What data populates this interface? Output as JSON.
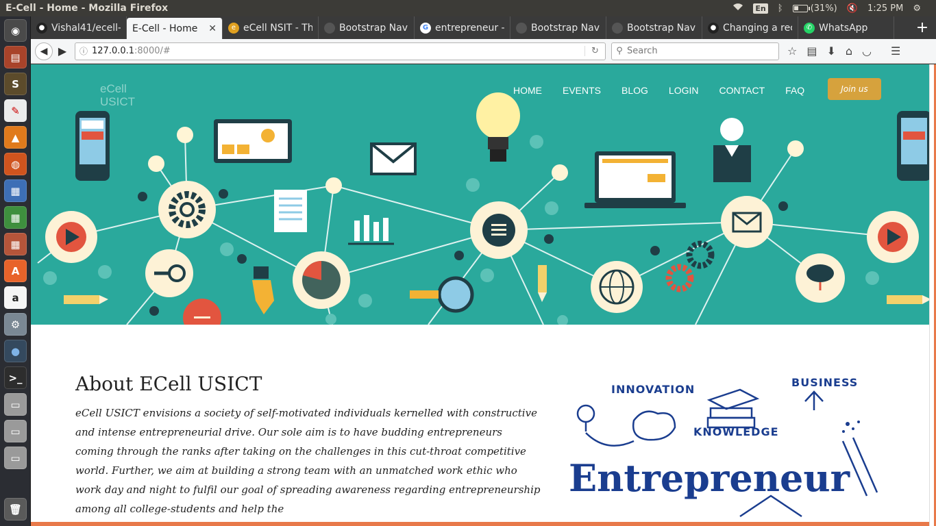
{
  "system": {
    "window_title": "E-Cell - Home - Mozilla Firefox",
    "keyboard_layout": "En",
    "battery": "(31%)",
    "clock": "1:25 PM"
  },
  "launcher": {
    "apps": [
      "ubuntu-dash-icon",
      "files-icon",
      "sublime-text-icon",
      "text-editor-icon",
      "vlc-icon",
      "firefox-icon",
      "libreoffice-writer-icon",
      "libreoffice-calc-icon",
      "libreoffice-impress-icon",
      "software-center-icon",
      "amazon-icon",
      "system-settings-icon",
      "drop-icon",
      "terminal-icon",
      "drive-icon",
      "drive-icon",
      "drive-icon",
      "trash-icon"
    ]
  },
  "tabs": [
    {
      "label": "Vishal41/ecell-",
      "icon": "github-icon",
      "color": "#222222"
    },
    {
      "label": "E-Cell - Home",
      "icon": "",
      "color": "",
      "active": true
    },
    {
      "label": "eCell NSIT - The",
      "icon": "ecell-icon",
      "color": "#e0a020"
    },
    {
      "label": "Bootstrap Nav",
      "icon": "bootstrap-icon",
      "color": "#555555"
    },
    {
      "label": "entrepreneur -",
      "icon": "google-icon",
      "color": "#ffffff"
    },
    {
      "label": "Bootstrap Nav",
      "icon": "bootstrap-icon",
      "color": "#555555"
    },
    {
      "label": "Bootstrap Nav",
      "icon": "bootstrap-icon",
      "color": "#555555"
    },
    {
      "label": "Changing a rec",
      "icon": "github-icon",
      "color": "#222222"
    },
    {
      "label": "WhatsApp",
      "icon": "whatsapp-icon",
      "color": "#25d366"
    }
  ],
  "url": {
    "host": "127.0.0.1",
    "path": ":8000/#"
  },
  "search": {
    "placeholder": "Search"
  },
  "site": {
    "brand_line1": "eCell",
    "brand_line2": "USICT",
    "menu": [
      "HOME",
      "EVENTS",
      "BLOG",
      "LOGIN",
      "CONTACT",
      "FAQ"
    ],
    "join_label": "Join us",
    "hero_color": "#2aa99c",
    "about_title": "About ECell USICT",
    "about_text": "eCell USICT envisions a society of self-motivated individuals kernelled with constructive and intense entrepreneurial drive. Our sole aim is to have budding entrepreneurs coming through the ranks after taking on the challenges in this cut-throat competitive world. Further, we aim at building a strong team with an unmatched work ethic who work day and night to fulfil our goal of spreading awareness regarding entrepreneurship among all college-students and help the",
    "illustration": {
      "innovation": "INNOVATION",
      "business": "BUSINESS",
      "knowledge": "KNOWLEDGE",
      "entrepreneur": "Entrepreneur"
    }
  }
}
